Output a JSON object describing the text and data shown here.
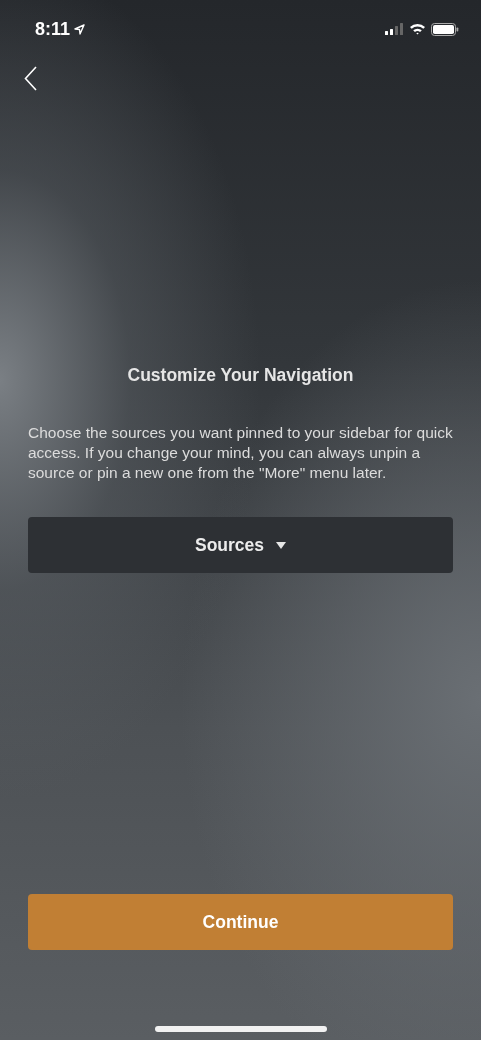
{
  "status_bar": {
    "time": "8:11"
  },
  "title": "Customize Your Navigation",
  "description": "Choose the sources you want pinned to your sidebar for quick access. If you change your mind, you can always unpin a source or pin a new one from the \"More\" menu later.",
  "dropdown": {
    "label": "Sources"
  },
  "continue_button": {
    "label": "Continue"
  }
}
